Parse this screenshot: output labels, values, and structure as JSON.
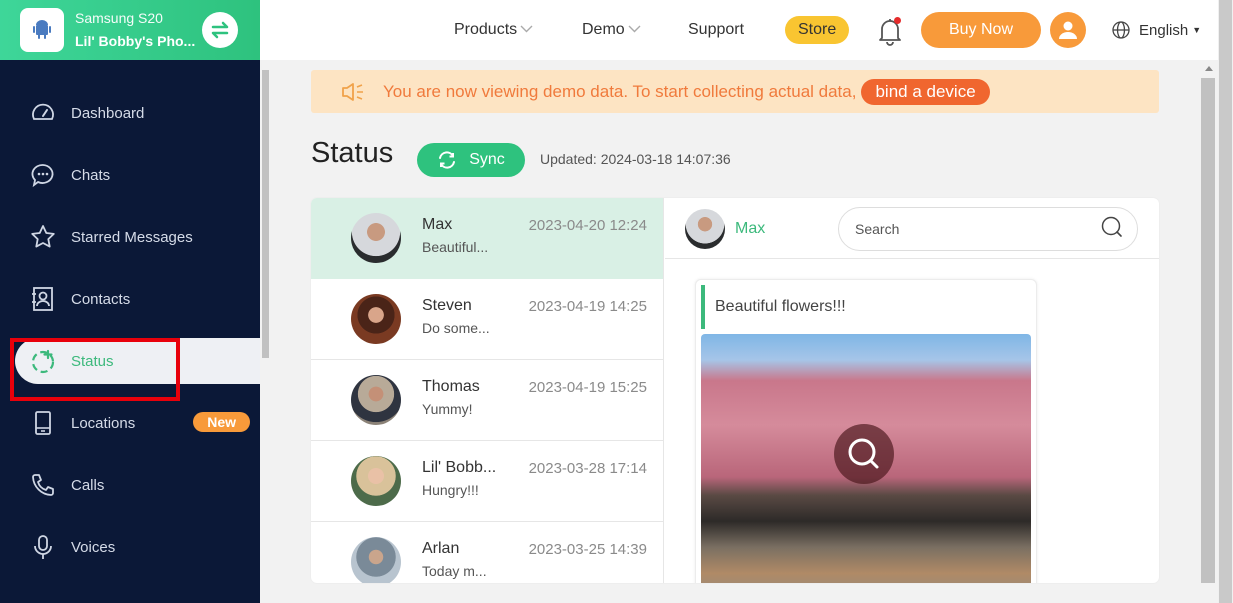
{
  "device": {
    "model": "Samsung S20",
    "name": "Lil' Bobby's Pho..."
  },
  "sidebar": {
    "items": [
      {
        "label": "Dashboard",
        "icon": "dashboard-icon"
      },
      {
        "label": "Chats",
        "icon": "chat-bubble-icon"
      },
      {
        "label": "Starred Messages",
        "icon": "star-icon"
      },
      {
        "label": "Contacts",
        "icon": "contacts-icon"
      },
      {
        "label": "Status",
        "icon": "status-add-icon",
        "active": true
      },
      {
        "label": "Locations",
        "icon": "phone-device-icon",
        "badge": "New"
      },
      {
        "label": "Calls",
        "icon": "phone-icon"
      },
      {
        "label": "Voices",
        "icon": "microphone-icon"
      }
    ]
  },
  "header": {
    "menu": {
      "products": "Products",
      "demo": "Demo",
      "support": "Support",
      "store": "Store"
    },
    "buy_now": "Buy Now",
    "language": "English"
  },
  "banner": {
    "text": "You are now viewing demo data. To start collecting actual data,",
    "action": "bind a device"
  },
  "page": {
    "title": "Status",
    "sync_label": "Sync",
    "updated": "Updated: 2024-03-18 14:07:36"
  },
  "status_list": [
    {
      "name": "Max",
      "message": "Beautiful...",
      "time": "2023-04-20 12:24",
      "active": true
    },
    {
      "name": "Steven",
      "message": "Do some...",
      "time": "2023-04-19 14:25"
    },
    {
      "name": "Thomas",
      "message": "Yummy!",
      "time": "2023-04-19 15:25"
    },
    {
      "name": "Lil' Bobb...",
      "message": "Hungry!!!",
      "time": "2023-03-28 17:14"
    },
    {
      "name": "Arlan",
      "message": "Today m...",
      "time": "2023-03-25 14:39"
    }
  ],
  "detail": {
    "name": "Max",
    "search_placeholder": "Search",
    "caption": "Beautiful flowers!!!"
  },
  "colors": {
    "accent_green": "#2ec27e",
    "sidebar_bg": "#0b1837",
    "orange": "#f89a3a",
    "store_yellow": "#f9c531",
    "highlight_red": "#e8000b"
  }
}
